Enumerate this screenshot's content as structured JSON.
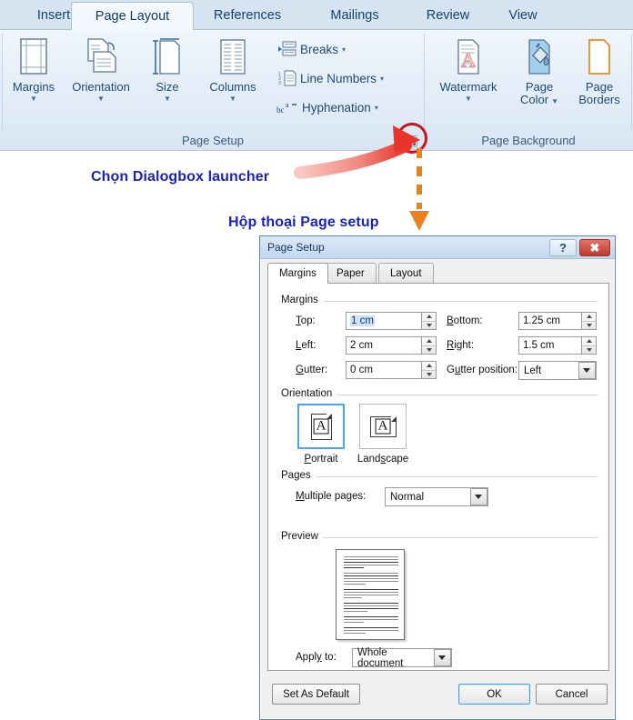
{
  "ribbon": {
    "tabs": [
      {
        "label": "Insert",
        "active": false
      },
      {
        "label": "Page Layout",
        "active": true
      },
      {
        "label": "References",
        "active": false
      },
      {
        "label": "Mailings",
        "active": false
      },
      {
        "label": "Review",
        "active": false
      },
      {
        "label": "View",
        "active": false
      }
    ],
    "groups": [
      {
        "name": "Page Setup",
        "label": "Page Setup"
      },
      {
        "name": "Page Background",
        "label": "Page Background"
      }
    ],
    "page_setup_buttons": [
      {
        "label": "Margins",
        "icon": "margins-icon",
        "has_caret": true
      },
      {
        "label": "Orientation",
        "icon": "orientation-icon",
        "has_caret": true
      },
      {
        "label": "Size",
        "icon": "size-icon",
        "has_caret": true
      },
      {
        "label": "Columns",
        "icon": "columns-icon",
        "has_caret": true
      }
    ],
    "page_setup_small_buttons": [
      {
        "label": "Breaks",
        "icon": "breaks-icon",
        "caret": "▾"
      },
      {
        "label": "Line Numbers",
        "icon": "line-numbers-icon",
        "caret": "▾"
      },
      {
        "label": "Hyphenation",
        "icon": "hyphenation-icon",
        "caret": "▾"
      }
    ],
    "page_background_buttons": [
      {
        "label": "Watermark",
        "icon": "watermark-icon",
        "has_caret": true
      },
      {
        "label": "Page Color",
        "label_line1": "Page",
        "label_line2": "Color",
        "icon": "page-color-icon",
        "has_caret": true
      },
      {
        "label": "Page Borders",
        "label_line1": "Page",
        "label_line2": "Borders",
        "icon": "page-borders-icon",
        "has_caret": false
      }
    ],
    "launcher_name": "Page Setup dialog box launcher"
  },
  "annotations": [
    {
      "text": "Chọn Dialogbox launcher",
      "color": "#1a23b8"
    },
    {
      "text": "Hộp thoại Page setup",
      "color": "#1a23b8"
    }
  ],
  "dialog": {
    "title": "Page Setup",
    "help_label": "?",
    "close_label": "✖",
    "tabs": [
      {
        "label": "Margins",
        "active": true
      },
      {
        "label": "Paper",
        "active": false
      },
      {
        "label": "Layout",
        "active": false
      }
    ],
    "margins_group": {
      "legend": "Margins",
      "fields": [
        {
          "label": "Top:",
          "accel": "T",
          "value": "1 cm",
          "selected": true
        },
        {
          "label": "Bottom:",
          "accel": "B",
          "value": "1.25 cm",
          "selected": false
        },
        {
          "label": "Left:",
          "accel": "L",
          "value": "2 cm",
          "selected": false
        },
        {
          "label": "Right:",
          "accel": "R",
          "value": "1.5 cm",
          "selected": false
        },
        {
          "label": "Gutter:",
          "accel": "G",
          "value": "0 cm",
          "selected": false
        }
      ],
      "gutter_position": {
        "label": "Gutter position:",
        "value": "Left"
      }
    },
    "orientation_group": {
      "legend": "Orientation",
      "options": [
        {
          "label": "Portrait",
          "selected": true
        },
        {
          "label": "Landscape",
          "selected": false
        }
      ]
    },
    "pages_group": {
      "legend": "Pages",
      "multiple_pages": {
        "label": "Multiple pages:",
        "value": "Normal"
      }
    },
    "preview_group": {
      "legend": "Preview",
      "apply_to": {
        "label": "Apply to:",
        "value": "Whole document"
      }
    },
    "buttons": {
      "set_as_default": "Set As Default",
      "ok": "OK",
      "cancel": "Cancel"
    }
  },
  "colors": {
    "highlight_circle": "#c4151c",
    "arrow_red": "#e8453c",
    "arrow_orange": "#e8821e",
    "annotation_blue": "#1a23b8",
    "ribbon_blue": "#d6e3f0"
  }
}
